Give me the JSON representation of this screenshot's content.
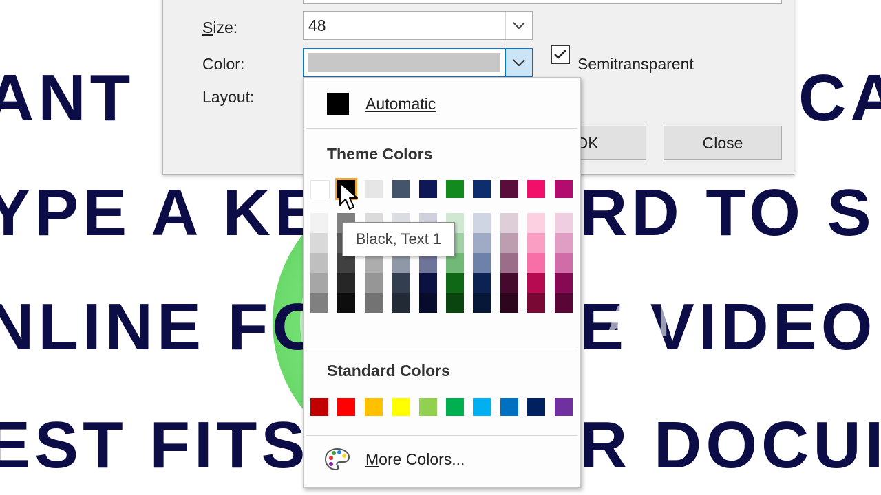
{
  "background": {
    "lines": [
      "ANT",
      "CAI",
      "YPE A KE",
      "RD TO S",
      "NLINE FO",
      "E VIDEO",
      "EST FITS",
      "R DOCUI"
    ],
    "logo_text": "AN"
  },
  "dialog": {
    "size_label": "Size:",
    "size_value": "48",
    "color_label": "Color:",
    "layout_label": "Layout:",
    "semitransparent_label": "Semitransparent",
    "semitransparent_checked": true,
    "ok_label": "OK",
    "close_label": "Close"
  },
  "palette": {
    "automatic_label": "Automatic",
    "automatic_color": "#000000",
    "theme_title": "Theme Colors",
    "theme_colors": [
      "#ffffff",
      "#000000",
      "#e7e6e6",
      "#44546a",
      "#0f1757",
      "#138a1d",
      "#0e2d6e",
      "#5a0c3b",
      "#f20f6a",
      "#b10c6e"
    ],
    "standard_title": "Standard Colors",
    "standard_colors": [
      "#c00000",
      "#ff0000",
      "#ffc000",
      "#ffff00",
      "#92d050",
      "#00b050",
      "#00b0f0",
      "#0070c0",
      "#002060",
      "#7030a0"
    ],
    "more_label": "More Colors...",
    "hover_tooltip": "Black, Text 1",
    "selected_index": 1
  }
}
